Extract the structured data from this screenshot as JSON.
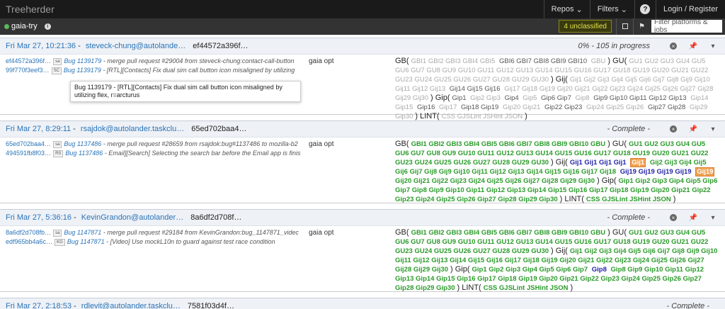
{
  "nav": {
    "brand": "Treeherder",
    "repos": "Repos",
    "filters": "Filters",
    "help": "?",
    "login": "Login / Register"
  },
  "subnav": {
    "repo": "gaia-try",
    "info": "i",
    "unclassified": "4 unclassified",
    "filter_placeholder": "Filter platforms & jobs"
  },
  "pushes": [
    {
      "date": "Fri Mar 27, 10:21:36",
      "author": "steveck-chung@autolande…",
      "rev": "ef44572a396f…",
      "status": "0% - 105 in progress",
      "revisions": [
        {
          "hash": "ef44572a396f…",
          "badge": "sa",
          "bug": "Bug 1139179",
          "msg": "- merge pull request #29004 from steveck-chung:contact-call-button"
        },
        {
          "hash": "99f770f3eef3…",
          "badge": "SC",
          "bug": "Bug 1139179",
          "msg": "- [RTL][Contacts] Fix dual sim call button icon misaligned by utilizing"
        }
      ],
      "platform": "gaia opt",
      "tooltip": "Bug 1139179 - [RTL][Contacts] Fix dual sim call button icon misaligned by utilizing flex, r=arcturus"
    },
    {
      "date": "Fri Mar 27, 8:29:11",
      "author": "rsajdok@autolander.taskclu…",
      "rev": "65ed702baa4…",
      "status": "- Complete -",
      "revisions": [
        {
          "hash": "65ed702baa4…",
          "badge": "sa",
          "bug": "Bug 1137486",
          "msg": "- merge pull request #28659 from rsajdok:bug#1137486 to mozilla-b2"
        },
        {
          "hash": "494591fb8f03…",
          "badge": "RS",
          "bug": "Bug 1137486",
          "msg": "- Email][Search] Selecting the search bar before the Email app is finis"
        }
      ],
      "platform": "gaia opt"
    },
    {
      "date": "Fri Mar 27, 5:36:16",
      "author": "KevinGrandon@autolander…",
      "rev": "8a6df2d708f…",
      "status": "- Complete -",
      "revisions": [
        {
          "hash": "8a6df2d708fb…",
          "badge": "sa",
          "bug": "Bug 1147871",
          "msg": "- merge pull request #29184 from KevinGrandon:bug_1147871_videc"
        },
        {
          "hash": "edf965bb4a6c…",
          "badge": "KG",
          "bug": "Bug 1147871",
          "msg": "- [Video] Use mockL10n to guard against test race condition"
        }
      ],
      "platform": "gaia opt"
    }
  ],
  "lastpush": {
    "date": "Fri Mar 27, 2:18:53",
    "author": "rdlevit@autolander.taskclu…",
    "rev": "7581f03d4f…",
    "status": "- Complete -"
  }
}
